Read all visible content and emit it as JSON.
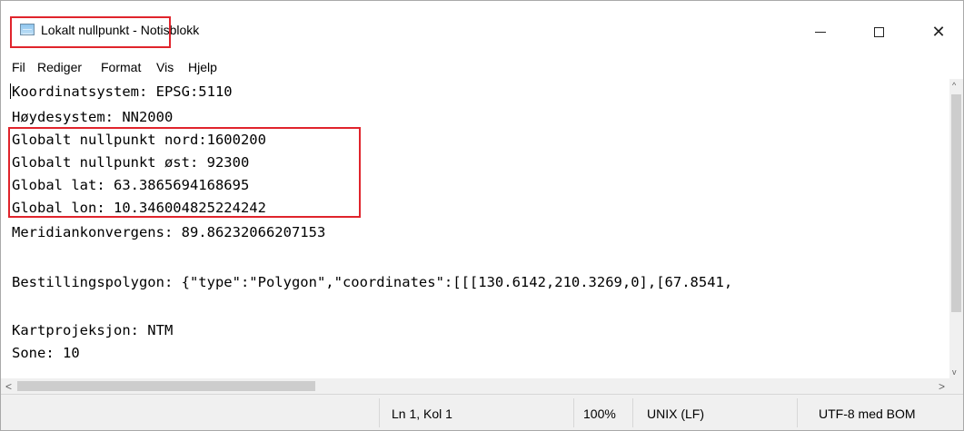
{
  "window": {
    "title": "Lokalt nullpunkt - Notisblokk",
    "controls": {
      "minimize": "—",
      "close": "✕"
    }
  },
  "menu": {
    "items": [
      "Fil",
      "Rediger",
      "Format",
      "Vis",
      "Hjelp"
    ]
  },
  "document": {
    "lines": [
      "Koordinatsystem: EPSG:5110",
      "Høydesystem: NN2000",
      "Globalt nullpunkt nord:1600200",
      "Globalt nullpunkt øst: 92300",
      "Global lat: 63.3865694168695",
      "Global lon: 10.346004825224242",
      "Meridiankonvergens: 89.86232066207153",
      "",
      "Bestillingspolygon: {\"type\":\"Polygon\",\"coordinates\":[[[130.6142,210.3269,0],[67.8541,",
      "",
      "Kartprojeksjon: NTM",
      "Sone: 10"
    ]
  },
  "scrollbars": {
    "up_arrow": "^",
    "down_arrow": "v",
    "left_arrow": "<",
    "right_arrow": ">"
  },
  "statusbar": {
    "position": "Ln 1, Kol 1",
    "zoom": "100%",
    "line_ending": "UNIX (LF)",
    "encoding": "UTF-8 med BOM"
  },
  "colors": {
    "highlight": "#e0242c"
  }
}
